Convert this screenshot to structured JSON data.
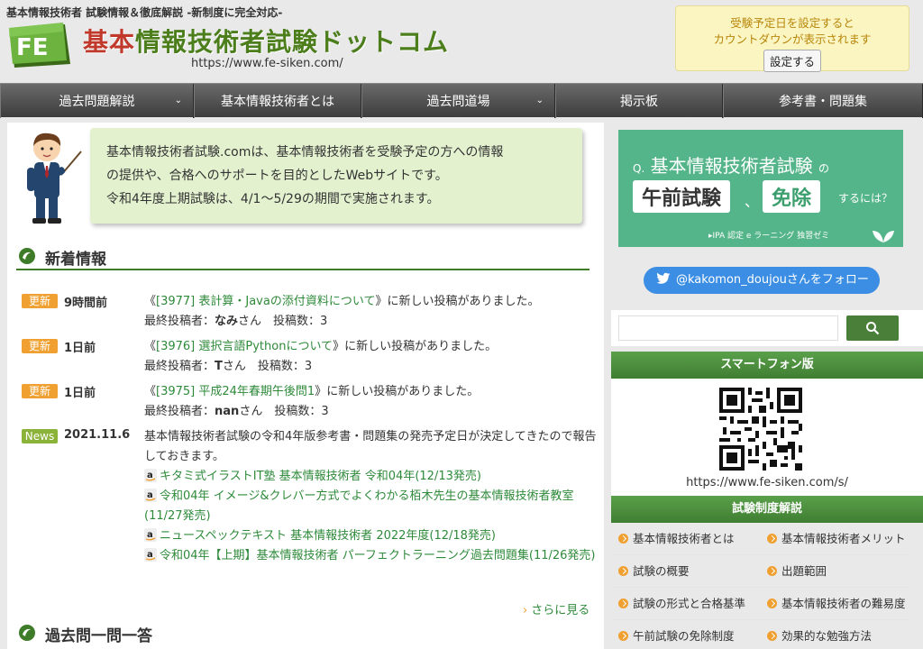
{
  "header": {
    "tagline": "基本情報技術者 試験情報＆徹底解説 -新制度に完全対応-",
    "logo_text": "FE",
    "site_title_accent": "基本",
    "site_title_rest": "情報技術者試験ドットコム",
    "site_url": "https://www.fe-siken.com/",
    "countdown_line1": "受験予定日を設定すると",
    "countdown_line2": "カウントダウンが表示されます",
    "countdown_button": "設定する"
  },
  "nav": {
    "items": [
      {
        "label": "過去問題解説",
        "has_dropdown": true
      },
      {
        "label": "基本情報技術者とは",
        "has_dropdown": false
      },
      {
        "label": "過去問道場",
        "has_dropdown": true
      },
      {
        "label": "掲示板",
        "has_dropdown": false
      },
      {
        "label": "参考書・問題集",
        "has_dropdown": false
      }
    ]
  },
  "intro": {
    "line1": "基本情報技術者試験.comは、基本情報技術者を受験予定の方への情報",
    "line2": "の提供や、合格へのサポートを目的としたWebサイトです。",
    "line3": "令和4年度上期試験は、4/1〜5/29の期間で実施されます。"
  },
  "news": {
    "title": "新着情報",
    "items": [
      {
        "badge": "更新",
        "when": "9時間前",
        "pre": "《",
        "link": "[3977] 表計算・Javaの添付資料について",
        "post": "》に新しい投稿がありました。",
        "poster_label": "最終投稿者：",
        "poster": "なみ",
        "poster_suffix": "さん　投稿数：3"
      },
      {
        "badge": "更新",
        "when": "1日前",
        "pre": "《",
        "link": "[3976] 選択言語Pythonについて",
        "post": "》に新しい投稿がありました。",
        "poster_label": "最終投稿者：",
        "poster": "T",
        "poster_suffix": "さん　投稿数：3"
      },
      {
        "badge": "更新",
        "when": "1日前",
        "pre": "《",
        "link": "[3975] 平成24年春期午後問1",
        "post": "》に新しい投稿がありました。",
        "poster_label": "最終投稿者：",
        "poster": "nan",
        "poster_suffix": "さん　投稿数：3"
      }
    ],
    "news_item": {
      "badge": "News",
      "when": "2021.11.6",
      "text": "基本情報技術者試験の令和4年版参考書・問題集の発売予定日が決定してきたので報告しておきます。",
      "books": [
        "キタミ式イラストIT塾 基本情報技術者 令和04年(12/13発売)",
        "令和04年 イメージ&クレバー方式でよくわかる栢木先生の基本情報技術者教室(11/27発売)",
        "ニュースペックテキスト 基本情報技術者 2022年度(12/18発売)",
        "令和04年【上期】基本情報技術者 パーフェクトラーニング過去問題集(11/26発売)"
      ]
    },
    "more": "さらに見る"
  },
  "qa": {
    "title": "過去問一問一答"
  },
  "sidebar": {
    "banner": {
      "q_prefix": "Q.",
      "q_title": "基本情報技術者試験",
      "q_no": "の",
      "pill1": "午前試験",
      "pill_sep": "、",
      "pill2": "免除",
      "suffix": "するには？",
      "foot": "▸IPA 認定 e ラーニング 独習ゼミ"
    },
    "twitter_label": "@kakomon_doujouさんをフォロー",
    "search_placeholder": "",
    "smartphone_title": "スマートフォン版",
    "smartphone_url": "https://www.fe-siken.com/s/",
    "exam_title": "試験制度解説",
    "exam_items": [
      "基本情報技術者とは",
      "基本情報技術者メリット",
      "試験の概要",
      "出題範囲",
      "試験の形式と合格基準",
      "基本情報技術者の難易度",
      "午前試験の免除制度",
      "効果的な勉強方法"
    ]
  },
  "colors": {
    "brand_green": "#4c7e1c",
    "link_green": "#2e8a3a",
    "update_orange": "#f0a030",
    "news_green": "#8bb33a",
    "twitter_blue": "#3b8ee3",
    "banner_teal": "#55b58a"
  }
}
